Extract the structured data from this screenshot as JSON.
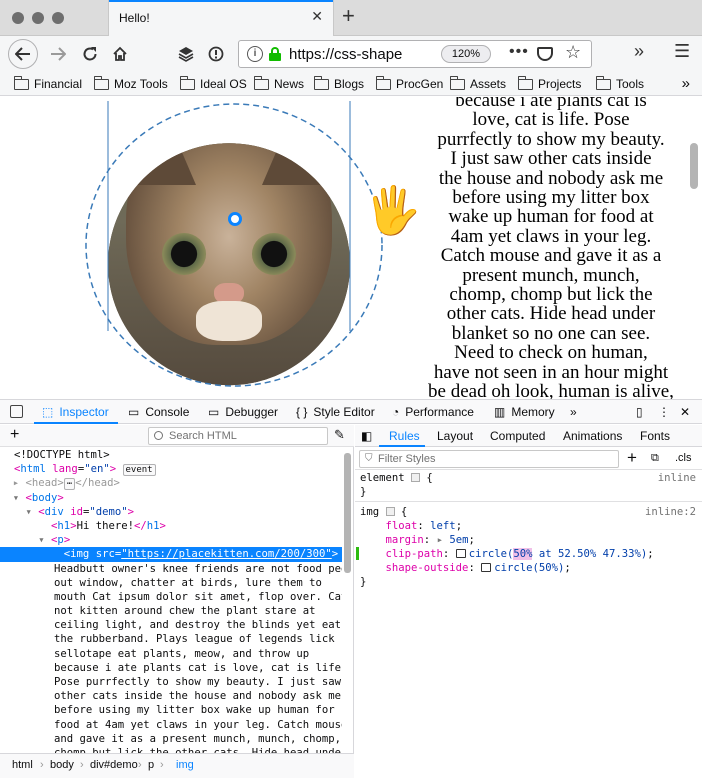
{
  "browser": {
    "tab_title": "Hello!",
    "tab_close": "✕",
    "new_tab": "+",
    "url_host": "https://css-shape",
    "zoom": "120%",
    "url_more": "•••",
    "overflow": "»",
    "menu": "☰"
  },
  "bookmarks": [
    "Financial",
    "Moz Tools",
    "Ideal OS",
    "News",
    "Blogs",
    "ProcGen",
    "Assets",
    "Projects",
    "Tools"
  ],
  "page": {
    "prose_lines": [
      "because i ate plants cat is",
      "love, cat is life. Pose",
      "purrfectly to show my beauty.",
      "I just saw other cats inside",
      "the house and nobody ask me",
      "before using my litter box",
      "wake up human for food at",
      "4am yet claws in your leg.",
      "Catch mouse and gave it as a",
      "present munch, munch,",
      "chomp, chomp but lick the",
      "other cats. Hide head under",
      "blanket so no one can see.",
      "Need to check on human,",
      "have not seen in an hour might",
      "be dead oh look, human is alive,"
    ]
  },
  "devtools": {
    "tabs": [
      "Inspector",
      "Console",
      "Debugger",
      "Style Editor",
      "Performance",
      "Memory"
    ],
    "more_tabs": "»",
    "close": "✕",
    "search_placeholder": "Search HTML",
    "markup": {
      "doctype": "<!DOCTYPE html>",
      "html_open_attr": "lang",
      "html_open_val": "\"en\"",
      "event_badge": "event",
      "ellipsis_badge": "⋯",
      "demo_id": "\"demo\"",
      "h1_text": "Hi there!",
      "img_src": "\"https://placekitten.com/200/300\"",
      "text_lines": [
        "Headbutt owner's knee friends are not food peer",
        "out window, chatter at birds, lure them to",
        "mouth Cat ipsum dolor sit amet, flop over. Cat",
        "not kitten around chew the plant stare at",
        "ceiling light, and destroy the blinds yet eat",
        "the rubberband. Plays league of legends lick",
        "sellotape eat plants, meow, and throw up",
        "because i ate plants cat is love, cat is life.",
        "Pose purrfectly to show my beauty. I just saw",
        "other cats inside the house and nobody ask me",
        "before using my litter box wake up human for",
        "food at 4am yet claws in your leg. Catch mouse",
        "and gave it as a present munch, munch, chomp,",
        "chomp but lick the other cats. Hide head under"
      ]
    },
    "breadcrumbs": [
      "html",
      "body",
      "div#demo",
      "p",
      "img"
    ],
    "rules_tabs": [
      "Rules",
      "Layout",
      "Computed",
      "Animations",
      "Fonts"
    ],
    "filter_placeholder": "Filter Styles",
    "cls": ".cls",
    "add_rule": "+",
    "element_rule": {
      "selector": "element",
      "source": "inline"
    },
    "img_rule": {
      "selector": "img",
      "source": "inline:2",
      "decls": [
        {
          "prop": "float",
          "val": "left"
        },
        {
          "prop": "margin",
          "val": "5em"
        },
        {
          "prop": "clip-path",
          "val_fn": "circle(",
          "val_hl": "50%",
          "val_rest": " at 52.50% 47.33%)"
        },
        {
          "prop": "shape-outside",
          "val_fn": "circle(50%)"
        }
      ]
    }
  }
}
